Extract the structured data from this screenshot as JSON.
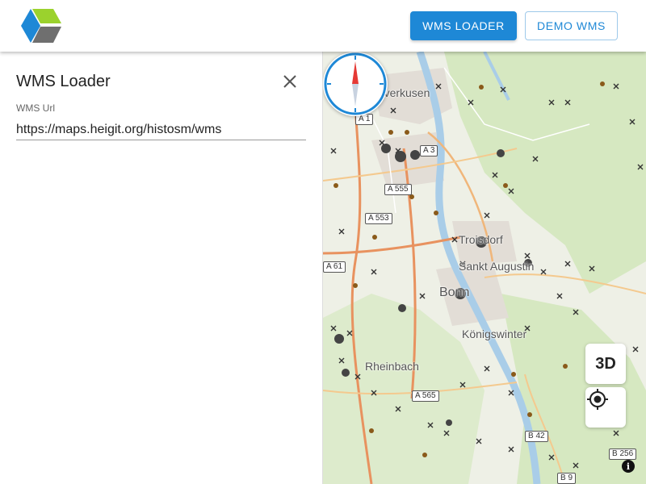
{
  "header": {
    "logo_icon": "cube-logo-icon",
    "wms_loader_button": "WMS LOADER",
    "demo_wms_button": "DEMO WMS"
  },
  "panel": {
    "title": "WMS Loader",
    "close_icon": "close-icon",
    "url_label": "WMS Url",
    "url_value": "https://maps.heigit.org/histosm/wms"
  },
  "map": {
    "places": [
      "Leverkusen",
      "Troisdorf",
      "Sankt Augustin",
      "Bonn",
      "Königswinter",
      "Rheinbach"
    ],
    "roads": [
      "A 1",
      "A 3",
      "A 555",
      "A 553",
      "A 61",
      "A 565",
      "B 9",
      "B 42",
      "B 256",
      "A 1"
    ],
    "controls": {
      "compass_icon": "compass-icon",
      "three_d_label": "3D",
      "locate_icon": "locate-icon",
      "info_label": "i"
    }
  },
  "colors": {
    "primary": "#1e88d6",
    "primary_outline": "#9ec9ea",
    "compass_ring": "#1e88d6",
    "compass_north": "#e53935"
  }
}
